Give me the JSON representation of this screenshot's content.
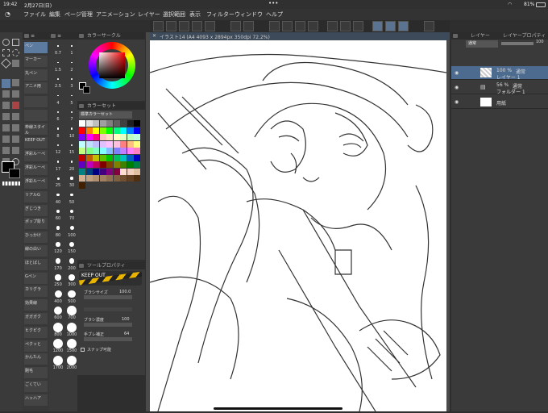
{
  "status": {
    "time": "19:42",
    "date": "2月27日(日)",
    "dots": "•••",
    "battery": "81%"
  },
  "menu": [
    "ファイル",
    "編集",
    "ページ管理",
    "アニメーション",
    "レイヤー",
    "選択範囲",
    "表示",
    "フィルター",
    "ウィンドウ",
    "ヘルプ"
  ],
  "doc_tab": "イラスト14 (A4 4093 x 2894px 350dpi 72.2%)",
  "subtools": [
    "ペン",
    "マーカー",
    "丸ペン",
    "アニメ用",
    "",
    "",
    "枠線スタイル",
    "KEEP OUT",
    "浮彩ルーペ",
    "浮彩ルーペ",
    "浮彩ルーペ",
    "リアルG",
    "ぎじつき",
    "ポップ彫り",
    "ひっかけ",
    "線の白い",
    "ほとばし",
    "Gペン",
    "カリグラ",
    "効果線",
    "ガガガク",
    "ヒクピク",
    "ペクッと",
    "かんたん",
    "剛毛",
    "ごくてい",
    "ハッハア"
  ],
  "brush_sizes": [
    "0.7",
    "1",
    "1.5",
    "2",
    "2.5",
    "3",
    "4",
    "5",
    "6",
    "7",
    "8",
    "10",
    "12",
    "15",
    "17",
    "20",
    "25",
    "30",
    "40",
    "50",
    "60",
    "70",
    "80",
    "100",
    "120",
    "150",
    "170",
    "200",
    "250",
    "300",
    "400",
    "500",
    "600",
    "700",
    "800",
    "1000",
    "1200",
    "1500",
    "1700",
    "2000"
  ],
  "palette_titles": {
    "wheel": "カラーサークル",
    "set": "カラーセット",
    "set_name": "標準カラーセット",
    "tool": "ツールプロパティ",
    "tool_name": "KEEP OUT"
  },
  "tool_props": {
    "size_label": "ブラシサイズ",
    "size_val": "100.0",
    "opacity_label": "ブラシ濃度",
    "opacity_val": "100",
    "stabil_label": "手ブレ補正",
    "stabil_val": "64",
    "snap_label": "スナップ可能",
    "tooltip_label": "ツールプロパティ"
  },
  "layers": {
    "title": "レイヤー",
    "title2": "レイヤープロパティ",
    "blend": "通常",
    "opacity": "100",
    "items": [
      {
        "pct": "100 %",
        "mode": "通常",
        "name": "レイヤー 1"
      },
      {
        "pct": "56 %",
        "mode": "通常",
        "name": "フォルダー 1"
      },
      {
        "pct": "",
        "mode": "",
        "name": "用紙"
      }
    ]
  },
  "colors": {
    "accent": "#3c7fc0",
    "panel": "#3a3a3a"
  },
  "swatches": [
    "#ffffff",
    "#e0e0e0",
    "#c0c0c0",
    "#a0a0a0",
    "#808080",
    "#606060",
    "#404040",
    "#202020",
    "#000000",
    "#ff0000",
    "#ff8000",
    "#ffff00",
    "#80ff00",
    "#00ff00",
    "#00ff80",
    "#00ffff",
    "#0080ff",
    "#0000ff",
    "#8000ff",
    "#ff00ff",
    "#ff0080",
    "#ffc0c0",
    "#ffe0c0",
    "#ffffc0",
    "#e0ffc0",
    "#c0ffc0",
    "#c0ffe0",
    "#c0ffff",
    "#c0e0ff",
    "#c0c0ff",
    "#e0c0ff",
    "#ffc0ff",
    "#ffc0e0",
    "#ff8080",
    "#ffc080",
    "#ffff80",
    "#c0ff80",
    "#80ff80",
    "#80ffc0",
    "#80ffff",
    "#80c0ff",
    "#8080ff",
    "#c080ff",
    "#ff80ff",
    "#ff80c0",
    "#c00000",
    "#c06000",
    "#c0c000",
    "#60c000",
    "#00c000",
    "#00c060",
    "#00c0c0",
    "#0060c0",
    "#0000c0",
    "#6000c0",
    "#c000c0",
    "#c00060",
    "#800000",
    "#804000",
    "#808000",
    "#408000",
    "#008000",
    "#008040",
    "#008080",
    "#004080",
    "#000080",
    "#400080",
    "#800080",
    "#800040",
    "#ffe0d0",
    "#f0d0c0",
    "#e0c0a0",
    "#d0b090",
    "#c0a080",
    "#b09070",
    "#a08060",
    "#907050",
    "#806040",
    "#705030",
    "#604020",
    "#503010",
    "#402000"
  ]
}
